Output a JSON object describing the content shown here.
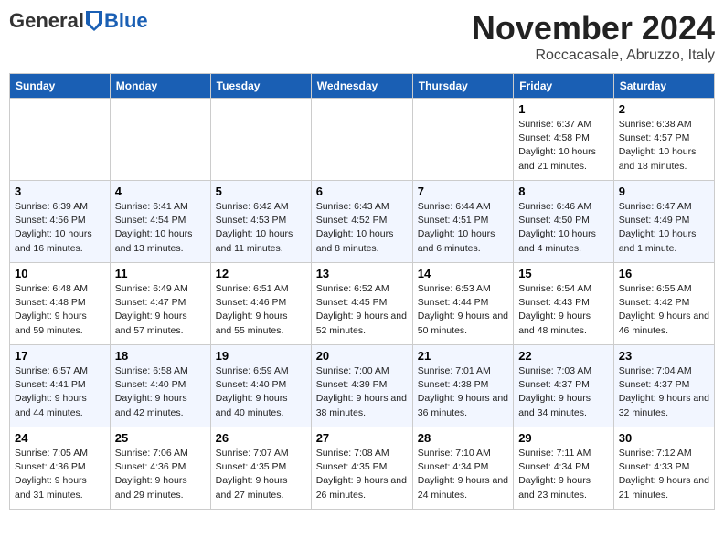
{
  "header": {
    "logo_general": "General",
    "logo_blue": "Blue",
    "month_title": "November 2024",
    "location": "Roccacasale, Abruzzo, Italy"
  },
  "days_of_week": [
    "Sunday",
    "Monday",
    "Tuesday",
    "Wednesday",
    "Thursday",
    "Friday",
    "Saturday"
  ],
  "weeks": [
    [
      {
        "day": "",
        "info": ""
      },
      {
        "day": "",
        "info": ""
      },
      {
        "day": "",
        "info": ""
      },
      {
        "day": "",
        "info": ""
      },
      {
        "day": "",
        "info": ""
      },
      {
        "day": "1",
        "info": "Sunrise: 6:37 AM\nSunset: 4:58 PM\nDaylight: 10 hours and 21 minutes."
      },
      {
        "day": "2",
        "info": "Sunrise: 6:38 AM\nSunset: 4:57 PM\nDaylight: 10 hours and 18 minutes."
      }
    ],
    [
      {
        "day": "3",
        "info": "Sunrise: 6:39 AM\nSunset: 4:56 PM\nDaylight: 10 hours and 16 minutes."
      },
      {
        "day": "4",
        "info": "Sunrise: 6:41 AM\nSunset: 4:54 PM\nDaylight: 10 hours and 13 minutes."
      },
      {
        "day": "5",
        "info": "Sunrise: 6:42 AM\nSunset: 4:53 PM\nDaylight: 10 hours and 11 minutes."
      },
      {
        "day": "6",
        "info": "Sunrise: 6:43 AM\nSunset: 4:52 PM\nDaylight: 10 hours and 8 minutes."
      },
      {
        "day": "7",
        "info": "Sunrise: 6:44 AM\nSunset: 4:51 PM\nDaylight: 10 hours and 6 minutes."
      },
      {
        "day": "8",
        "info": "Sunrise: 6:46 AM\nSunset: 4:50 PM\nDaylight: 10 hours and 4 minutes."
      },
      {
        "day": "9",
        "info": "Sunrise: 6:47 AM\nSunset: 4:49 PM\nDaylight: 10 hours and 1 minute."
      }
    ],
    [
      {
        "day": "10",
        "info": "Sunrise: 6:48 AM\nSunset: 4:48 PM\nDaylight: 9 hours and 59 minutes."
      },
      {
        "day": "11",
        "info": "Sunrise: 6:49 AM\nSunset: 4:47 PM\nDaylight: 9 hours and 57 minutes."
      },
      {
        "day": "12",
        "info": "Sunrise: 6:51 AM\nSunset: 4:46 PM\nDaylight: 9 hours and 55 minutes."
      },
      {
        "day": "13",
        "info": "Sunrise: 6:52 AM\nSunset: 4:45 PM\nDaylight: 9 hours and 52 minutes."
      },
      {
        "day": "14",
        "info": "Sunrise: 6:53 AM\nSunset: 4:44 PM\nDaylight: 9 hours and 50 minutes."
      },
      {
        "day": "15",
        "info": "Sunrise: 6:54 AM\nSunset: 4:43 PM\nDaylight: 9 hours and 48 minutes."
      },
      {
        "day": "16",
        "info": "Sunrise: 6:55 AM\nSunset: 4:42 PM\nDaylight: 9 hours and 46 minutes."
      }
    ],
    [
      {
        "day": "17",
        "info": "Sunrise: 6:57 AM\nSunset: 4:41 PM\nDaylight: 9 hours and 44 minutes."
      },
      {
        "day": "18",
        "info": "Sunrise: 6:58 AM\nSunset: 4:40 PM\nDaylight: 9 hours and 42 minutes."
      },
      {
        "day": "19",
        "info": "Sunrise: 6:59 AM\nSunset: 4:40 PM\nDaylight: 9 hours and 40 minutes."
      },
      {
        "day": "20",
        "info": "Sunrise: 7:00 AM\nSunset: 4:39 PM\nDaylight: 9 hours and 38 minutes."
      },
      {
        "day": "21",
        "info": "Sunrise: 7:01 AM\nSunset: 4:38 PM\nDaylight: 9 hours and 36 minutes."
      },
      {
        "day": "22",
        "info": "Sunrise: 7:03 AM\nSunset: 4:37 PM\nDaylight: 9 hours and 34 minutes."
      },
      {
        "day": "23",
        "info": "Sunrise: 7:04 AM\nSunset: 4:37 PM\nDaylight: 9 hours and 32 minutes."
      }
    ],
    [
      {
        "day": "24",
        "info": "Sunrise: 7:05 AM\nSunset: 4:36 PM\nDaylight: 9 hours and 31 minutes."
      },
      {
        "day": "25",
        "info": "Sunrise: 7:06 AM\nSunset: 4:36 PM\nDaylight: 9 hours and 29 minutes."
      },
      {
        "day": "26",
        "info": "Sunrise: 7:07 AM\nSunset: 4:35 PM\nDaylight: 9 hours and 27 minutes."
      },
      {
        "day": "27",
        "info": "Sunrise: 7:08 AM\nSunset: 4:35 PM\nDaylight: 9 hours and 26 minutes."
      },
      {
        "day": "28",
        "info": "Sunrise: 7:10 AM\nSunset: 4:34 PM\nDaylight: 9 hours and 24 minutes."
      },
      {
        "day": "29",
        "info": "Sunrise: 7:11 AM\nSunset: 4:34 PM\nDaylight: 9 hours and 23 minutes."
      },
      {
        "day": "30",
        "info": "Sunrise: 7:12 AM\nSunset: 4:33 PM\nDaylight: 9 hours and 21 minutes."
      }
    ]
  ]
}
